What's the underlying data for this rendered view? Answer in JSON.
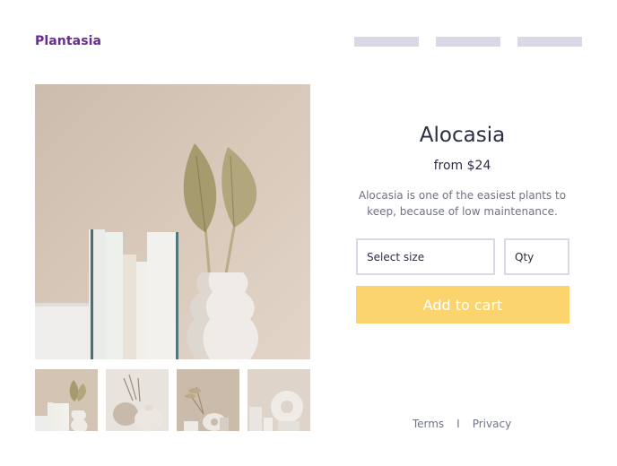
{
  "header": {
    "logo": "Plantasia"
  },
  "product": {
    "name": "Alocasia",
    "price": "from $24",
    "description": "Alocasia is one of the easiest plants to keep, because of low maintenance.",
    "size_select_label": "Select size",
    "qty_label": "Qty",
    "add_to_cart_label": "Add to cart"
  },
  "gallery": {
    "thumbnail_count": 4
  },
  "footer": {
    "terms": "Terms",
    "separator": "I",
    "privacy": "Privacy"
  },
  "colors": {
    "brand": "#6a2c8e",
    "cta": "#fbd46d",
    "placeholder_nav": "#d9d8e6",
    "text_dark": "#2b2d42",
    "text_muted": "#6f7385"
  }
}
